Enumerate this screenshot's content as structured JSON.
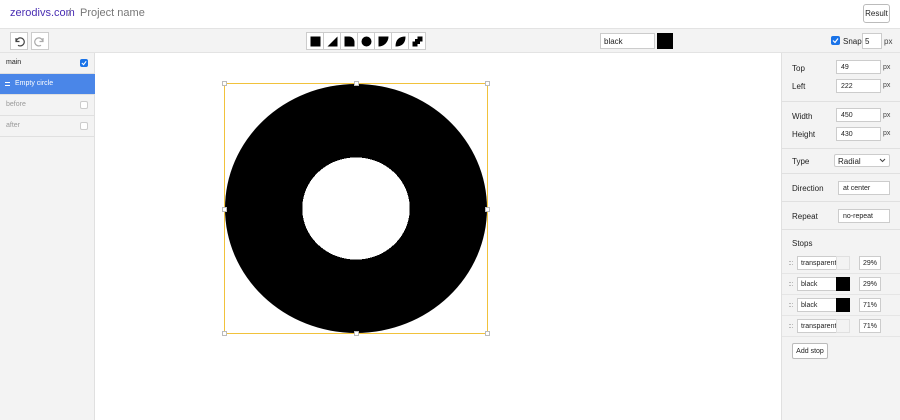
{
  "header": {
    "brand": "zerodivs.com",
    "separator": "/",
    "project_name": "Project name",
    "result_label": "Result"
  },
  "toolbar": {
    "undo_icon": "undo-icon",
    "redo_icon": "redo-icon",
    "shape_tools": [
      {
        "name": "square-shape",
        "icon": "square-icon"
      },
      {
        "name": "triangle-shape",
        "icon": "triangle-icon"
      },
      {
        "name": "rounded-corner-shape",
        "icon": "rounded-corner-icon"
      },
      {
        "name": "circle-shape",
        "icon": "circle-icon"
      },
      {
        "name": "half-round-shape",
        "icon": "half-round-icon"
      },
      {
        "name": "leaf-shape",
        "icon": "leaf-icon"
      },
      {
        "name": "checker-shape",
        "icon": "checker-icon"
      }
    ],
    "color_value": "black",
    "color_hex": "#000000",
    "snap_label": "Snap",
    "snap_checked": true,
    "snap_value": "5",
    "snap_unit": "px"
  },
  "layers": [
    {
      "label": "main",
      "checked": true,
      "active": false,
      "dim": false
    },
    {
      "label": "Empty circle",
      "checked": false,
      "active": true,
      "dim": false
    },
    {
      "label": "before",
      "checked": false,
      "active": false,
      "dim": true
    },
    {
      "label": "after",
      "checked": false,
      "active": false,
      "dim": true
    }
  ],
  "properties": {
    "top_label": "Top",
    "top_value": "49",
    "top_unit": "px",
    "left_label": "Left",
    "left_value": "222",
    "left_unit": "px",
    "width_label": "Width",
    "width_value": "450",
    "width_unit": "px",
    "height_label": "Height",
    "height_value": "430",
    "height_unit": "px",
    "type_label": "Type",
    "type_value": "Radial",
    "direction_label": "Direction",
    "direction_value": "at center",
    "repeat_label": "Repeat",
    "repeat_value": "no-repeat",
    "stops_label": "Stops",
    "stops": [
      {
        "name": "transparent",
        "color": "transparent",
        "percent": "29%"
      },
      {
        "name": "black",
        "color": "#000000",
        "percent": "29%"
      },
      {
        "name": "black",
        "color": "#000000",
        "percent": "71%"
      },
      {
        "name": "transparent",
        "color": "transparent",
        "percent": "71%"
      }
    ],
    "add_stop_label": "Add stop"
  },
  "colors": {
    "accent": "#4a86e8",
    "brand": "#4a2fb3",
    "selection": "#f1c23b"
  }
}
